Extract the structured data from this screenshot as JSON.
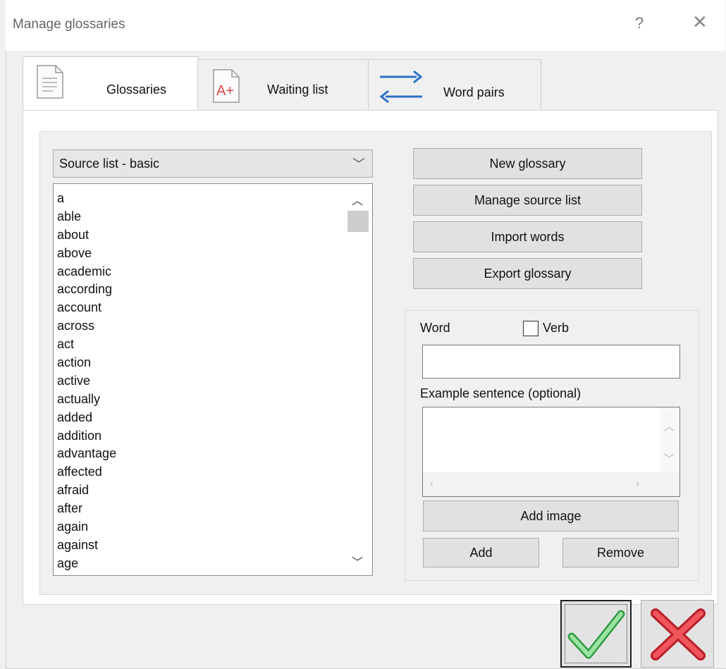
{
  "window": {
    "title": "Manage glossaries",
    "help_label": "?",
    "close_label": "✕"
  },
  "tabs": [
    {
      "label": "Glossaries",
      "icon": "document-icon",
      "active": true
    },
    {
      "label": "Waiting list",
      "icon": "grade-a-plus-icon",
      "active": false
    },
    {
      "label": "Word pairs",
      "icon": "swap-arrows-icon",
      "active": false
    }
  ],
  "source_select": {
    "value": "Source list - basic"
  },
  "words": [
    "a",
    "able",
    "about",
    "above",
    "academic",
    "according",
    "account",
    "across",
    "act",
    "action",
    "active",
    "actually",
    "added",
    "addition",
    "advantage",
    "affected",
    "afraid",
    "after",
    "again",
    "against",
    "age"
  ],
  "actions": {
    "new_glossary": "New glossary",
    "manage_source_list": "Manage source list",
    "import_words": "Import words",
    "export_glossary": "Export glossary"
  },
  "word_form": {
    "word_label": "Word",
    "verb_label": "Verb",
    "verb_checked": false,
    "word_value": "",
    "example_label": "Example sentence (optional)",
    "example_value": "",
    "add_image": "Add image",
    "add": "Add",
    "remove": "Remove"
  },
  "colors": {
    "ok_check": "#5cc26a",
    "cancel_x": "#e2373e"
  }
}
